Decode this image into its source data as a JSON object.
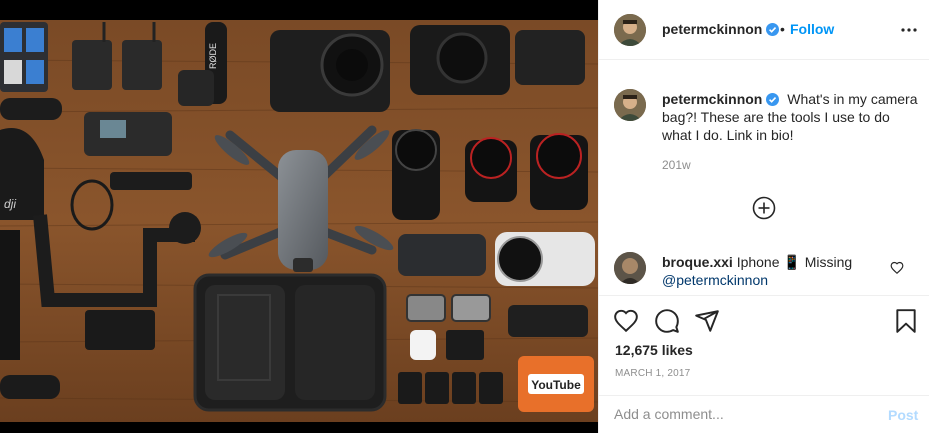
{
  "header": {
    "username": "petermckinnon",
    "dot": "•",
    "follow_label": "Follow"
  },
  "caption": {
    "username": "petermckinnon",
    "text": "What's in my camera bag?! These are the tools I use to do what I do. Link in bio!",
    "age": "201w"
  },
  "comment": {
    "username": "broque.xxi",
    "text": "Iphone 📱 Missing",
    "mention": "@petermckinnon"
  },
  "post_stats": {
    "likes": "12,675 likes",
    "date": "MARCH 1, 2017"
  },
  "add_comment": {
    "placeholder": "Add a comment...",
    "post_label": "Post"
  },
  "photo": {
    "brand_labels": [
      "RØDE",
      "dji",
      "YouTube"
    ]
  },
  "icons": [
    "verified-badge-icon",
    "more-options-icon",
    "load-more-comments-icon",
    "comment-like-heart-icon",
    "like-heart-icon",
    "comment-bubble-icon",
    "share-paper-plane-icon",
    "save-bookmark-icon"
  ],
  "colors": {
    "accent": "#0095f6",
    "text": "#262626",
    "muted": "#8e8e8e",
    "mention": "#00376b",
    "post_disabled": "#b3dbff",
    "divider": "#efefef"
  }
}
